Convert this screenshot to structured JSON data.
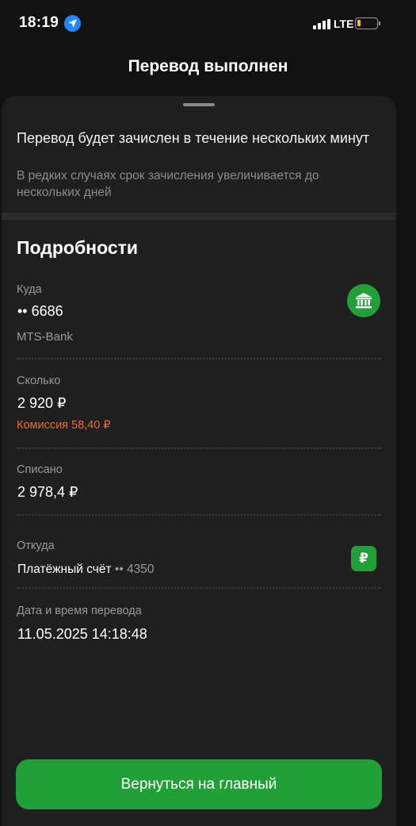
{
  "status_bar": {
    "time": "18:19",
    "network": "LTE",
    "icons": [
      "location-arrow-icon",
      "signal-icon",
      "battery-icon"
    ]
  },
  "header": {
    "title": "Перевод выполнен"
  },
  "notice": {
    "title": "Перевод будет зачислен в течение нескольких минут",
    "subtitle": "В редких случаях срок зачисления увеличивается до нескольких дней"
  },
  "details": {
    "title": "Подробности",
    "to": {
      "label": "Куда",
      "value": "•• 6686",
      "bank": "MTS-Bank",
      "icon": "bank-icon"
    },
    "amount": {
      "label": "Сколько",
      "value": "2 920 ₽",
      "fee": "Комиссия 58,40 ₽"
    },
    "debited": {
      "label": "Списано",
      "value": "2 978,4 ₽"
    },
    "from": {
      "label": "Откуда",
      "account_name": "Платёжный счёт",
      "account_number": "•• 4350",
      "icon": "ruble-icon",
      "icon_glyph": "₽"
    },
    "datetime": {
      "label": "Дата и время перевода",
      "value": "11.05.2025 14:18:48"
    }
  },
  "actions": {
    "return_label": "Вернуться на главный"
  },
  "colors": {
    "accent": "#21a038",
    "fee": "#f06a2c",
    "background": "#121212",
    "sheet": "#1f1f1f"
  }
}
